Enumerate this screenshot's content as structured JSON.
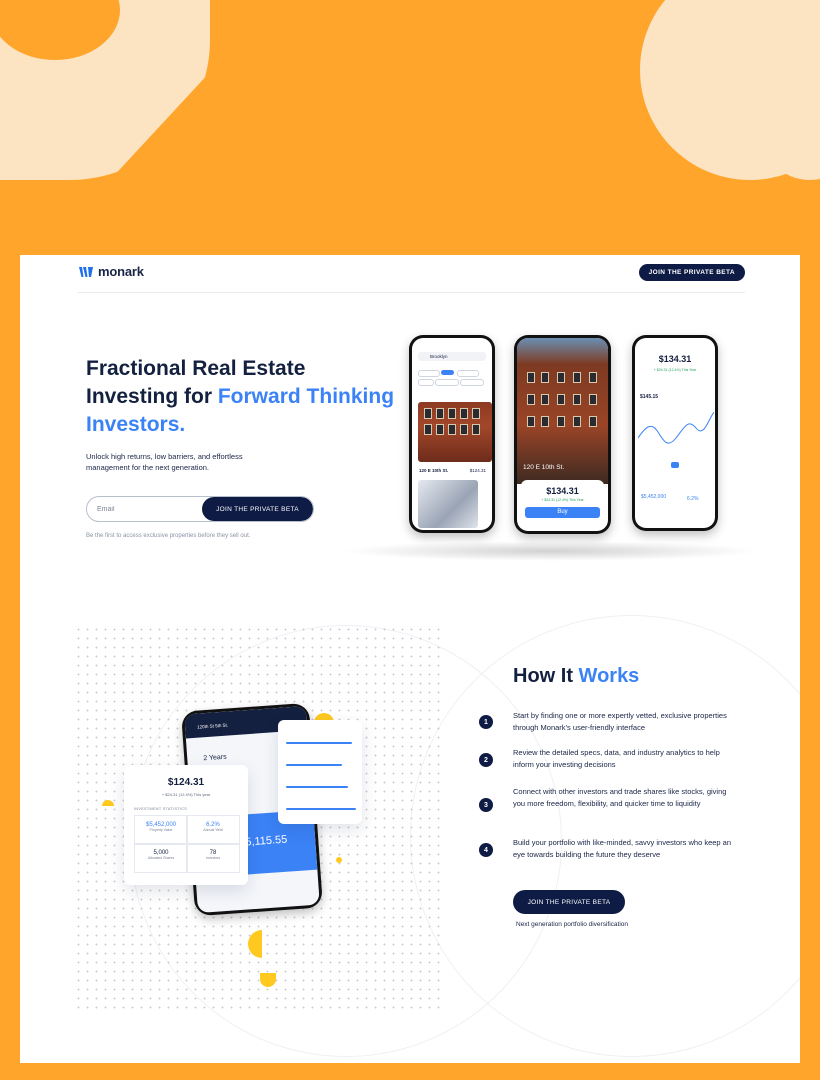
{
  "brand": {
    "name": "monark",
    "accent": "#3b82f6",
    "navy": "#0e1b45",
    "background": "#FFA52B"
  },
  "nav": {
    "cta_label": "JOIN THE PRIVATE BETA"
  },
  "hero": {
    "title_line1": "Fractional Real Estate",
    "title_line2_plain": "Investing for ",
    "title_line2_highlight": "Forward Thinking",
    "title_line3_highlight": "Investors.",
    "subtitle": "Unlock high returns, low barriers, and effortless management for the next generation.",
    "email_placeholder": "Email",
    "email_button": "JOIN THE PRIVATE BETA",
    "fine_print": "Be the first to access exclusive properties before they sell out."
  },
  "phones": {
    "left": {
      "search_value": "Brooklyn",
      "listing_label": "120 E 10th St.",
      "listing_price": "$124.31"
    },
    "center": {
      "address": "120 E 10th St.",
      "price": "$134.31",
      "change": "+ $24.31 (12.4%) This Year",
      "buy_label": "Buy"
    },
    "right": {
      "price": "$134.31",
      "change": "+ $24.31 (12.4%) This Year",
      "value": "$145.15",
      "stat1": "$5,452,000",
      "stat2": "6.2%"
    }
  },
  "illustration": {
    "card_price": "$124.31",
    "card_change": "+ $24.31 (12.4%) This year",
    "card_section": "INVESTMENT STATISTICS",
    "stat1_value": "$5,452,000",
    "stat1_label": "Property Value",
    "stat2_value": "6.2%",
    "stat2_label": "Annual Yield",
    "stat3_value": "5,000",
    "stat3_label": "Allocated Shares",
    "stat4_value": "78",
    "stat4_label": "Investors",
    "phone_title": "120th St 5th St.",
    "phone_years": "2 Years",
    "phone_big": "$5,115.55"
  },
  "how": {
    "title_plain": "How It ",
    "title_highlight": "Works",
    "steps": [
      {
        "num": "1",
        "text": "Start by finding one or more expertly vetted, exclusive properties through Monark’s user-friendly interface"
      },
      {
        "num": "2",
        "text": "Review the detailed specs, data, and industry analytics to help inform your investing decisions"
      },
      {
        "num": "3",
        "text": "Connect with other investors and trade shares like stocks, giving you more freedom, flexibility, and quicker time to liquidity"
      },
      {
        "num": "4",
        "text": "Build your portfolio with like-minded, savvy investors who keep an eye towards building the future they deserve"
      }
    ],
    "cta_label": "JOIN THE PRIVATE BETA",
    "cta_sub": "Next generation portfolio diversification"
  }
}
